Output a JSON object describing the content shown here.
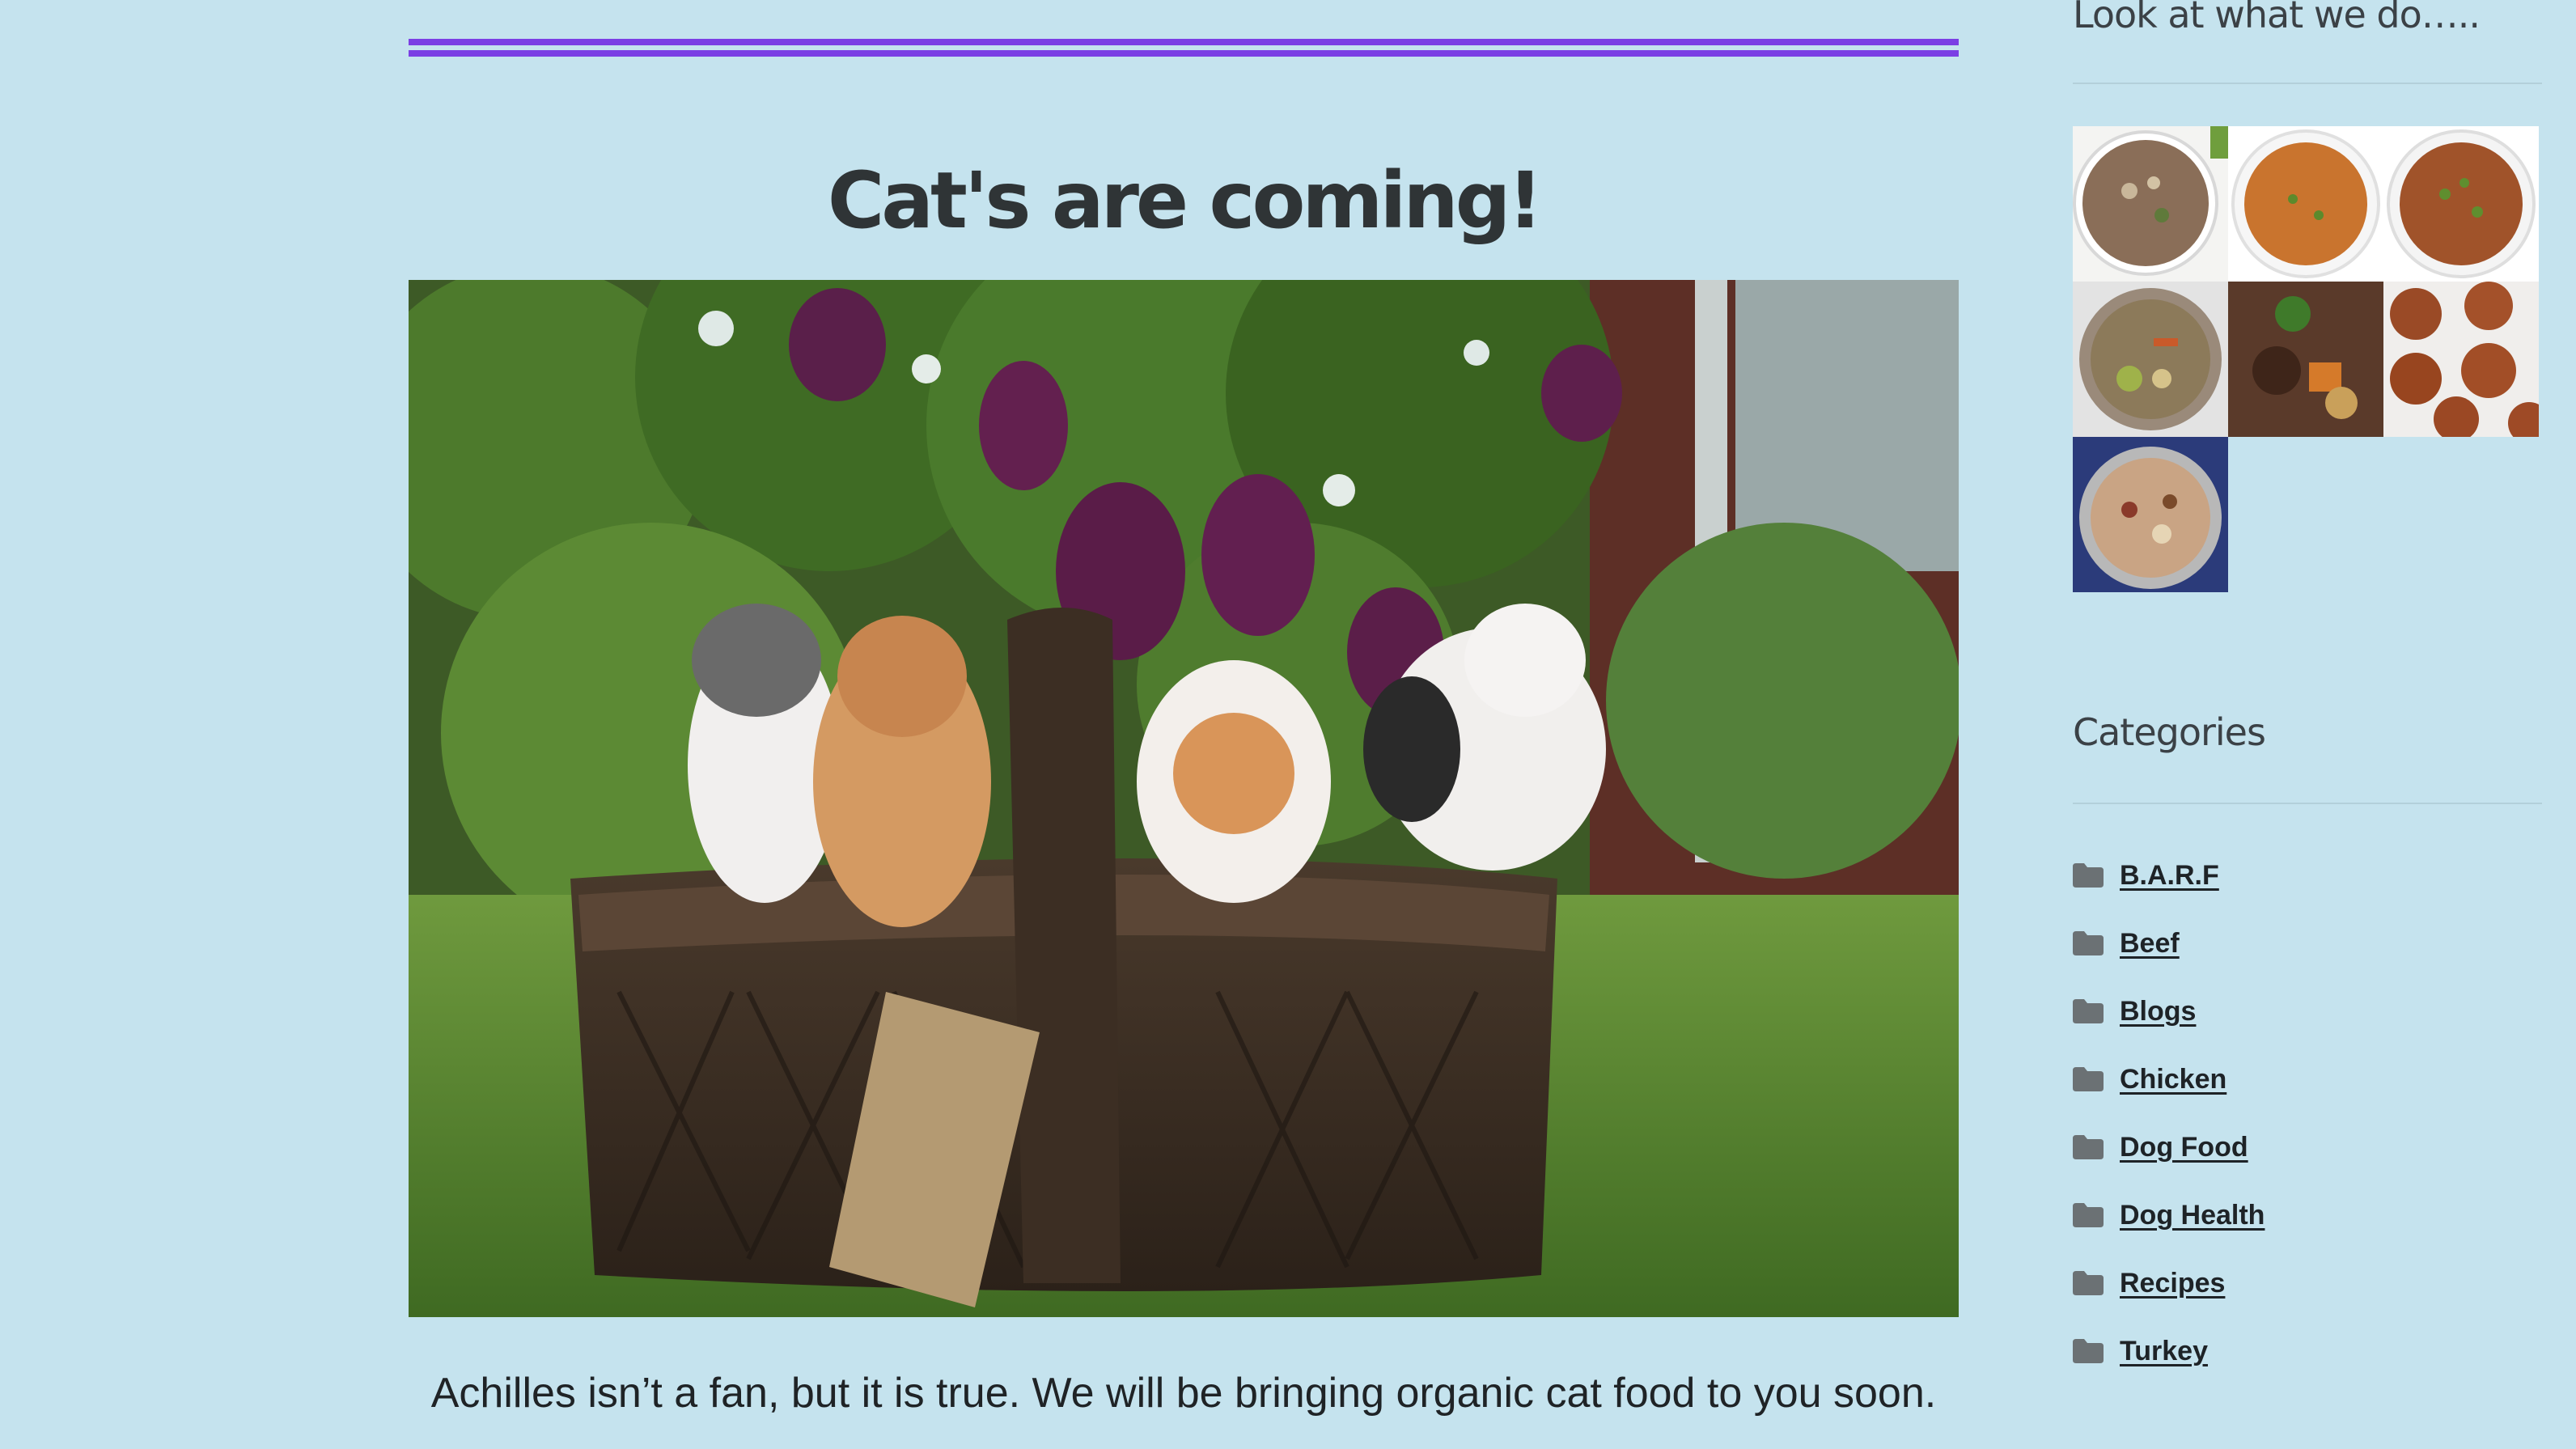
{
  "post": {
    "title": "Cat's are coming!",
    "body": "Achilles isn’t a fan, but it is true. We will be bringing organic cat food to you soon.",
    "image_alt": "Four kittens in a wicker basket"
  },
  "sidebar": {
    "gallery_title": "Look at what we do…..",
    "gallery_items": [
      {
        "alt": "Ground meat and vegetable dog food in bowl"
      },
      {
        "alt": "Orange grain and meat mix in white bowl"
      },
      {
        "alt": "Brown rice and pea mix in white bowl"
      },
      {
        "alt": "Chicken stew with broccoli and carrots"
      },
      {
        "alt": "Beef stew with potatoes and carrots"
      },
      {
        "alt": "Meatballs on a plate"
      },
      {
        "alt": "Mixed meat and rice in steel bowl"
      }
    ],
    "categories_title": "Categories",
    "categories": [
      {
        "label": "B.A.R.F"
      },
      {
        "label": "Beef"
      },
      {
        "label": "Blogs"
      },
      {
        "label": "Chicken"
      },
      {
        "label": "Dog Food"
      },
      {
        "label": "Dog Health"
      },
      {
        "label": "Recipes"
      },
      {
        "label": "Turkey"
      }
    ]
  },
  "colors": {
    "page_background": "#c5e3ee",
    "accent_rule": "#7b3fe4",
    "text_dark": "#2f3436"
  }
}
